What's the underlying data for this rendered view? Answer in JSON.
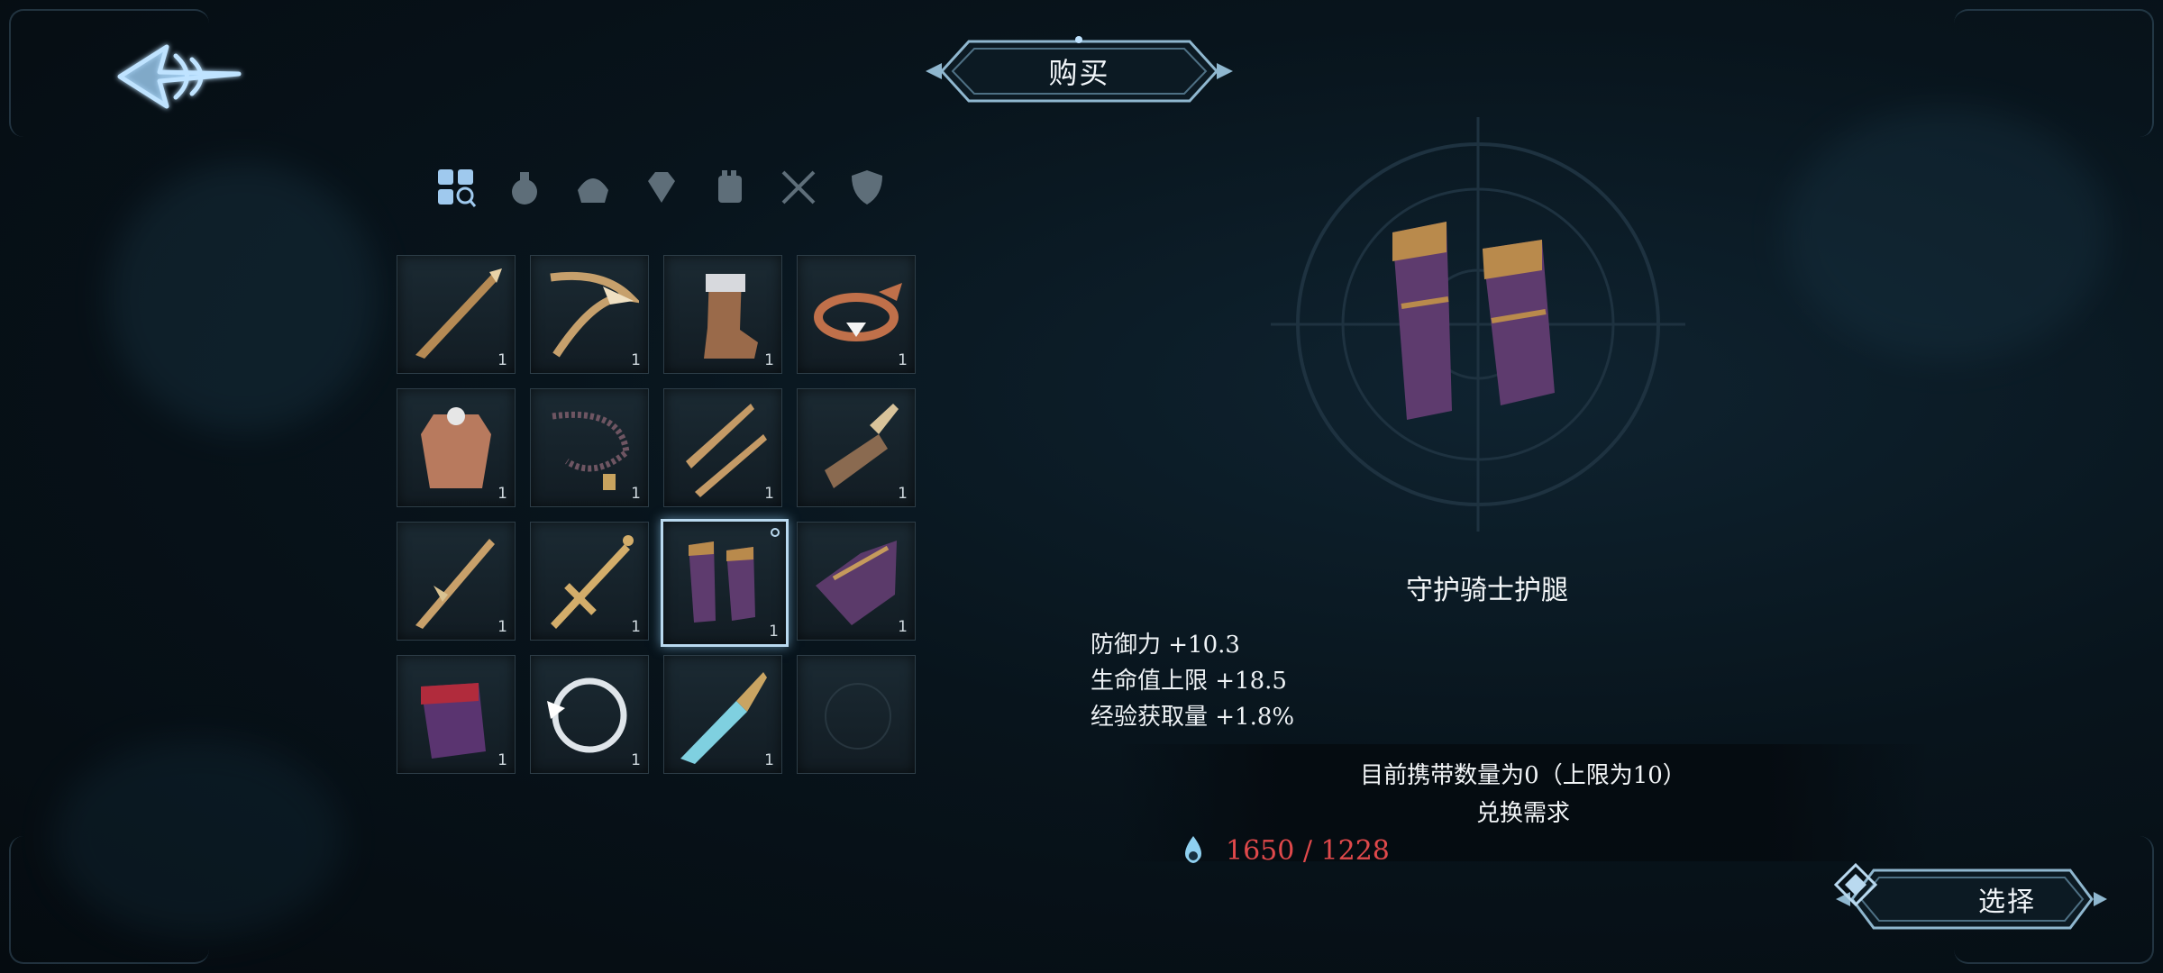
{
  "header": {
    "title": "购买"
  },
  "tabs": [
    {
      "icon": "grid-search-icon",
      "active": true
    },
    {
      "icon": "potion-icon",
      "active": false
    },
    {
      "icon": "helmet-icon",
      "active": false
    },
    {
      "icon": "gem-icon",
      "active": false
    },
    {
      "icon": "gauntlet-icon",
      "active": false
    },
    {
      "icon": "crossed-swords-icon",
      "active": false
    },
    {
      "icon": "shield-icon",
      "active": false
    }
  ],
  "items": [
    {
      "name": "spear",
      "qty": "1"
    },
    {
      "name": "scythe-bow",
      "qty": "1"
    },
    {
      "name": "boot",
      "qty": "1"
    },
    {
      "name": "amulet",
      "qty": "1"
    },
    {
      "name": "chest-armor",
      "qty": "1"
    },
    {
      "name": "bead-chain",
      "qty": "1"
    },
    {
      "name": "twin-blades",
      "qty": "1"
    },
    {
      "name": "greatsword",
      "qty": "1"
    },
    {
      "name": "lance",
      "qty": "1"
    },
    {
      "name": "cross-sword",
      "qty": "1"
    },
    {
      "name": "knight-greaves",
      "qty": "1",
      "selected": true
    },
    {
      "name": "purple-helm",
      "qty": "1"
    },
    {
      "name": "red-vambrace",
      "qty": "1"
    },
    {
      "name": "silver-ring",
      "qty": "1"
    },
    {
      "name": "crystal-sword",
      "qty": "1"
    },
    {
      "name": "empty",
      "qty": ""
    }
  ],
  "detail": {
    "name": "守护骑士护腿",
    "stats": [
      "防御力 +10.3",
      "生命值上限 +18.5",
      "经验获取量 +1.8%"
    ],
    "carry": "目前携带数量为0（上限为10）",
    "requirement_label": "兑换需求",
    "cost": "1650 / 1228"
  },
  "buttons": {
    "select": "选择"
  },
  "colors": {
    "cost": "#e0494b",
    "accent": "#9fc9ee"
  }
}
